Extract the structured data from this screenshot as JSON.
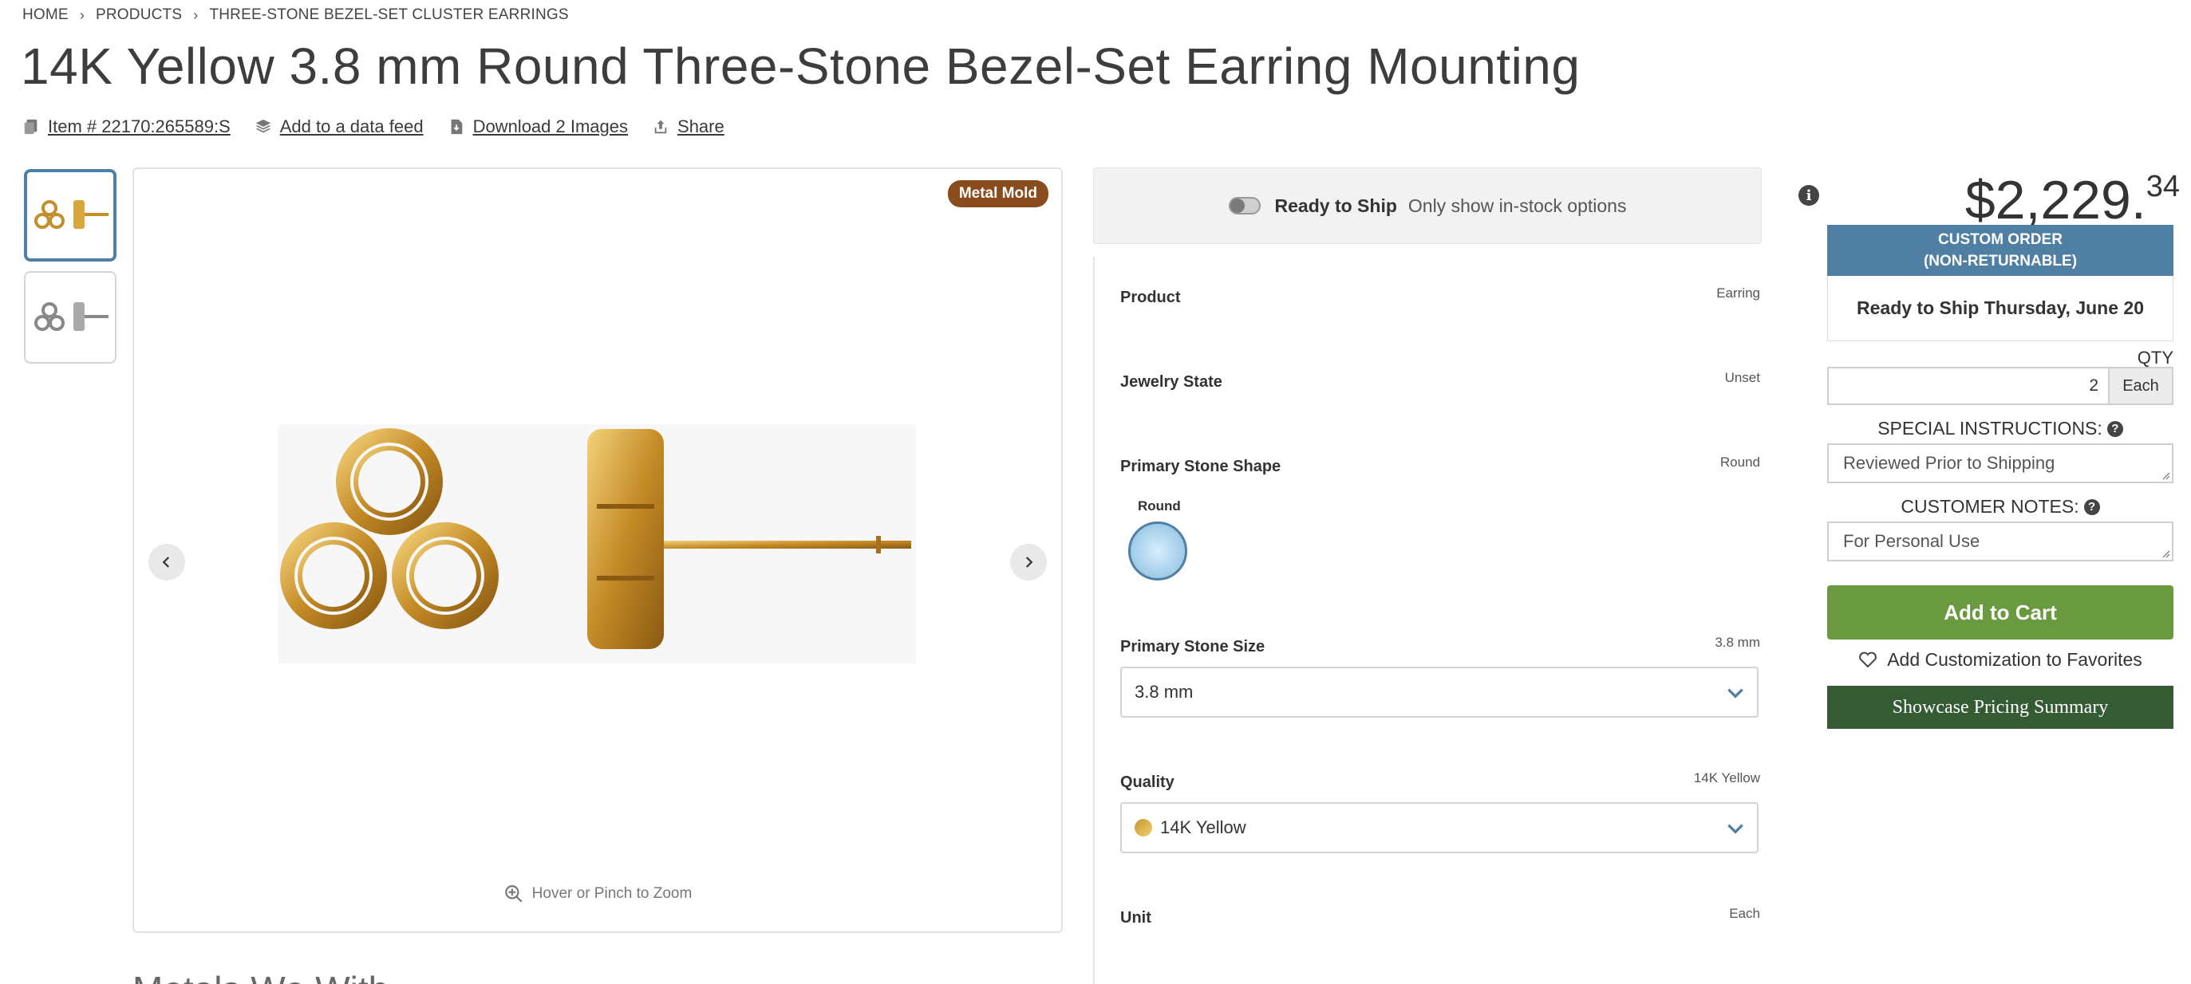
{
  "breadcrumb": {
    "items": [
      "HOME",
      "PRODUCTS",
      "THREE-STONE BEZEL-SET CLUSTER EARRINGS"
    ]
  },
  "product": {
    "title": "14K Yellow 3.8 mm Round Three-Stone Bezel-Set Earring Mounting"
  },
  "actions": {
    "item_number": "Item # 22170:265589:S",
    "add_feed": "Add to a data feed",
    "download": "Download 2 Images",
    "share": "Share"
  },
  "gallery": {
    "badge": "Metal Mold",
    "zoom_hint": "Hover or Pinch to Zoom",
    "thumb_count": 2
  },
  "below": {
    "heading": "Metals We With..."
  },
  "ready_to_ship": {
    "label": "Ready to Ship",
    "sub": "Only show in-stock options",
    "toggle_on": false
  },
  "options": {
    "product": {
      "label": "Product",
      "value": "Earring"
    },
    "jewelry_state": {
      "label": "Jewelry State",
      "value": "Unset"
    },
    "stone_shape": {
      "label": "Primary Stone Shape",
      "value": "Round",
      "swatch_label": "Round"
    },
    "stone_size": {
      "label": "Primary Stone Size",
      "value": "3.8 mm",
      "selected": "3.8 mm"
    },
    "quality": {
      "label": "Quality",
      "value": "14K Yellow",
      "selected": "14K Yellow"
    },
    "unit": {
      "label": "Unit",
      "value": "Each"
    }
  },
  "pricing": {
    "dollars": "$2,229.",
    "cents": "34",
    "custom_order_line1": "CUSTOM ORDER",
    "custom_order_line2": "(NON-RETURNABLE)",
    "ship_date": "Ready to Ship Thursday, June 20",
    "qty_label": "QTY",
    "qty_value": "2",
    "qty_unit": "Each",
    "special_label": "SPECIAL INSTRUCTIONS:",
    "special_value": "Reviewed Prior to Shipping",
    "notes_label": "CUSTOMER NOTES:",
    "notes_value": "For Personal Use",
    "add_to_cart": "Add to Cart",
    "favorites": "Add Customization to Favorites",
    "showcase": "Showcase Pricing Summary"
  },
  "colors": {
    "accent_blue": "#4f7fa3",
    "cart_green": "#6a9a3f",
    "showcase_green": "#355b34",
    "badge_brown": "#8a4c1c"
  }
}
